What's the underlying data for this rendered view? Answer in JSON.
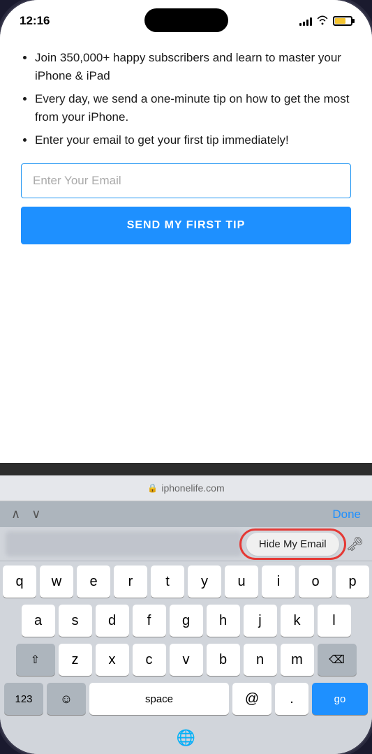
{
  "status_bar": {
    "time": "12:16",
    "signal_bars": [
      4,
      6,
      8,
      10,
      12
    ],
    "battery_level": 70
  },
  "content": {
    "bullets": [
      "Join 350,000+ happy subscribers and learn to master your iPhone & iPad",
      "Every day, we send a one-minute tip on how to get the most from your iPhone.",
      "Enter your email to get your first tip immediately!"
    ],
    "email_placeholder": "Enter Your Email",
    "cta_label": "SEND MY FIRST TIP"
  },
  "url_bar": {
    "domain": "iphonelife.com",
    "lock_symbol": "🔒"
  },
  "toolbar": {
    "nav_up": "∧",
    "nav_down": "∨",
    "done_label": "Done"
  },
  "autocomplete": {
    "hide_email_label": "Hide My Email",
    "key_icon": "🗝"
  },
  "keyboard": {
    "row1": [
      "q",
      "w",
      "e",
      "r",
      "t",
      "y",
      "u",
      "i",
      "o",
      "p"
    ],
    "row2": [
      "a",
      "s",
      "d",
      "f",
      "g",
      "h",
      "j",
      "k",
      "l"
    ],
    "row3": [
      "z",
      "x",
      "c",
      "v",
      "b",
      "n",
      "m"
    ],
    "bottom_left": "123",
    "emoji": "☺",
    "space": "space",
    "at": "@",
    "dot": ".",
    "go": "go",
    "globe": "🌐"
  }
}
